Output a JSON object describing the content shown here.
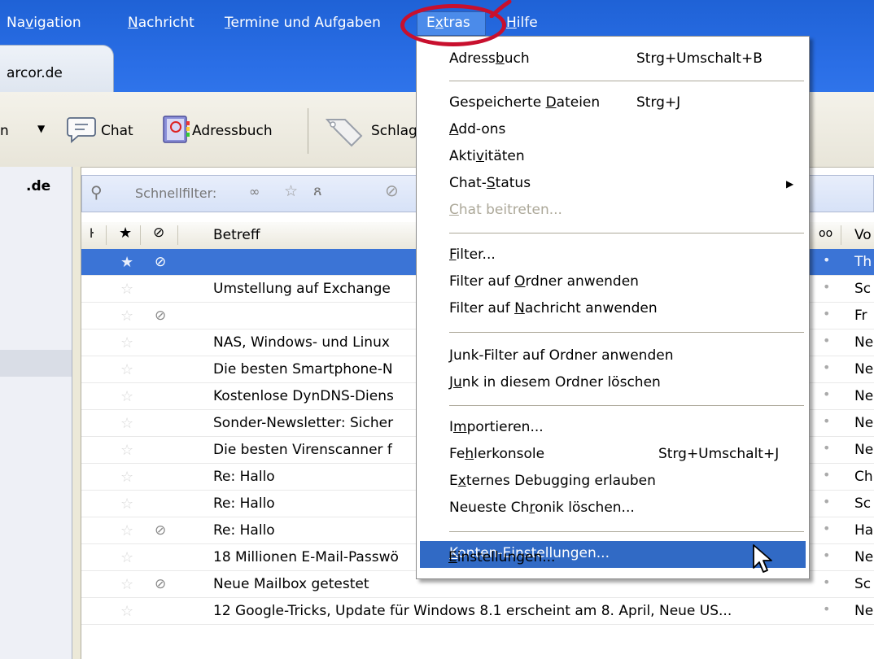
{
  "menubar": {
    "items": [
      {
        "id": "navigation",
        "label": "Navigation",
        "mnemonic_prefix": "Na",
        "mnemonic": "v",
        "rest": "igation"
      },
      {
        "id": "nachricht",
        "label": "Nachricht",
        "mnemonic_prefix": "",
        "mnemonic": "N",
        "rest": "achricht"
      },
      {
        "id": "termine",
        "label": "Termine und Aufgaben",
        "mnemonic_prefix": "",
        "mnemonic": "T",
        "rest": "ermine und Aufgaben"
      },
      {
        "id": "extras",
        "label": "Extras",
        "mnemonic_prefix": "E",
        "mnemonic": "x",
        "rest": "tras"
      },
      {
        "id": "hilfe",
        "label": "Hilfe",
        "mnemonic_prefix": "",
        "mnemonic": "H",
        "rest": "ilfe"
      }
    ]
  },
  "tab": {
    "label": "arcor.de"
  },
  "toolbar": {
    "cut_label": "n",
    "chat_label": "Chat",
    "addressbook_label": "Adressbuch",
    "tags_label": "Schlag"
  },
  "folderpane": {
    "account": ".de"
  },
  "quickfilter": {
    "label": "Schnellfilter:"
  },
  "columns": {
    "subject": "Betreff",
    "from": "Vo"
  },
  "rows": [
    {
      "subject": "",
      "from": "Th",
      "clip": true,
      "selected": true
    },
    {
      "subject": "Umstellung auf Exchange",
      "from": "Sc",
      "clip": false
    },
    {
      "subject": "",
      "from": "Fr",
      "clip": true
    },
    {
      "subject": "NAS, Windows- und Linux",
      "from": "Ne",
      "clip": false
    },
    {
      "subject": "Die besten Smartphone-N",
      "from": "Ne",
      "clip": false
    },
    {
      "subject": "Kostenlose DynDNS-Diens",
      "from": "Ne",
      "clip": false
    },
    {
      "subject": "Sonder-Newsletter: Sicher",
      "from": "Ne",
      "clip": false
    },
    {
      "subject": "Die besten Virenscanner f",
      "from": "Ne",
      "clip": false
    },
    {
      "subject": "Re: Hallo",
      "from": "Ch",
      "clip": false
    },
    {
      "subject": "Re: Hallo",
      "from": "Sc",
      "clip": false
    },
    {
      "subject": "Re: Hallo",
      "from": "Ha",
      "clip": true
    },
    {
      "subject": "18 Millionen E-Mail-Passwö",
      "from": "Ne",
      "clip": false
    },
    {
      "subject": "Neue Mailbox getestet",
      "from": "Sc",
      "clip": true
    },
    {
      "subject": "12 Google-Tricks, Update für Windows 8.1 erscheint am 8. April, Neue US...",
      "from": "Ne",
      "clip": false
    }
  ],
  "extras_menu": {
    "items": [
      {
        "id": "adressbuch",
        "pre": "Adress",
        "mn": "b",
        "post": "uch",
        "shortcut": "Strg+Umschalt+B"
      },
      {
        "id": "gespeicherte-dateien",
        "pre": "Gespeicherte ",
        "mn": "D",
        "post": "ateien",
        "shortcut": "Strg+J"
      },
      {
        "id": "add-ons",
        "pre": "",
        "mn": "A",
        "post": "dd-ons",
        "shortcut": ""
      },
      {
        "id": "aktivitaeten",
        "pre": "Akti",
        "mn": "v",
        "post": "itäten",
        "shortcut": ""
      },
      {
        "id": "chat-status",
        "pre": "Chat-",
        "mn": "S",
        "post": "tatus",
        "shortcut": ""
      },
      {
        "id": "chat-beitreten",
        "pre": "",
        "mn": "C",
        "post": "hat beitreten...",
        "shortcut": ""
      },
      {
        "id": "filter",
        "pre": "",
        "mn": "F",
        "post": "ilter...",
        "shortcut": ""
      },
      {
        "id": "filter-ordner",
        "pre": "Filter auf ",
        "mn": "O",
        "post": "rdner anwenden",
        "shortcut": ""
      },
      {
        "id": "filter-nachricht",
        "pre": "Filter auf ",
        "mn": "N",
        "post": "achricht anwenden",
        "shortcut": ""
      },
      {
        "id": "junk-filter",
        "pre": "",
        "mn": "J",
        "post": "unk-Filter auf Ordner anwenden",
        "shortcut": ""
      },
      {
        "id": "junk-loeschen",
        "pre": "J",
        "mn": "u",
        "post": "nk in diesem Ordner löschen",
        "shortcut": ""
      },
      {
        "id": "importieren",
        "pre": "I",
        "mn": "m",
        "post": "portieren...",
        "shortcut": ""
      },
      {
        "id": "fehlerkonsole",
        "pre": "Fe",
        "mn": "h",
        "post": "lerkonsole",
        "shortcut": "Strg+Umschalt+J"
      },
      {
        "id": "externes-debugging",
        "pre": "E",
        "mn": "x",
        "post": "ternes Debugging erlauben",
        "shortcut": ""
      },
      {
        "id": "chronik-loeschen",
        "pre": "Neueste Ch",
        "mn": "r",
        "post": "onik löschen...",
        "shortcut": ""
      },
      {
        "id": "konten-einstellungen",
        "pre": "",
        "mn": "K",
        "post": "onten-Einstellungen...",
        "shortcut": ""
      },
      {
        "id": "einstellungen",
        "pre": "",
        "mn": "E",
        "post": "instellungen...",
        "shortcut": ""
      }
    ]
  },
  "colors": {
    "titlebar": "#2a6ee6",
    "selection": "#3b74d6",
    "menu_highlight": "#316ac5",
    "annotation": "#c8102e"
  }
}
